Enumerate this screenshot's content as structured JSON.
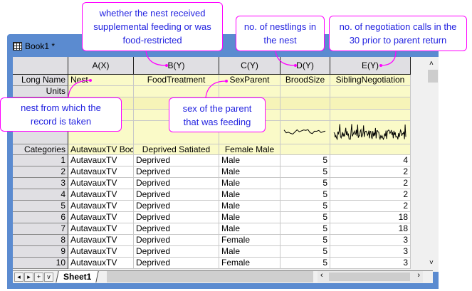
{
  "window": {
    "title": "Book1 *"
  },
  "columns": [
    {
      "header": "A(X)",
      "long_name": "Nest",
      "categories": "AutavauxTV Boc"
    },
    {
      "header": "B(Y)",
      "long_name": "FoodTreatment",
      "categories": "Deprived Satiated"
    },
    {
      "header": "C(Y)",
      "long_name": "SexParent",
      "categories": "Female Male"
    },
    {
      "header": "D(Y)",
      "long_name": "BroodSize",
      "categories": ""
    },
    {
      "header": "E(Y)",
      "long_name": "SiblingNegotiation",
      "categories": ""
    }
  ],
  "row_labels": {
    "long_name": "Long Name",
    "units": "Units",
    "categories": "Categories"
  },
  "rows": [
    [
      "1",
      "AutavauxTV",
      "Deprived",
      "Male",
      "5",
      "4"
    ],
    [
      "2",
      "AutavauxTV",
      "Deprived",
      "Male",
      "5",
      "2"
    ],
    [
      "3",
      "AutavauxTV",
      "Deprived",
      "Male",
      "5",
      "2"
    ],
    [
      "4",
      "AutavauxTV",
      "Deprived",
      "Male",
      "5",
      "2"
    ],
    [
      "5",
      "AutavauxTV",
      "Deprived",
      "Male",
      "5",
      "2"
    ],
    [
      "6",
      "AutavauxTV",
      "Deprived",
      "Male",
      "5",
      "18"
    ],
    [
      "7",
      "AutavauxTV",
      "Deprived",
      "Male",
      "5",
      "18"
    ],
    [
      "8",
      "AutavauxTV",
      "Deprived",
      "Female",
      "5",
      "3"
    ],
    [
      "9",
      "AutavauxTV",
      "Deprived",
      "Male",
      "5",
      "3"
    ],
    [
      "10",
      "AutavauxTV",
      "Deprived",
      "Female",
      "5",
      "3"
    ]
  ],
  "sheet_tab": "Sheet1",
  "tab_nav": [
    "◂",
    "▸",
    "+",
    "v"
  ],
  "callouts": {
    "food": "whether the nest received supplemental feeding or was food-restricted",
    "brood": "no. of nestlings in the nest",
    "negotiation": "no. of negotiation calls in the 30 prior to parent return",
    "nest": "nest from which the record is taken",
    "sex": "sex of the parent that was feeding"
  },
  "colors": {
    "callout_border": "#ff00ff",
    "callout_text": "#2323e0",
    "window_frame": "#5b8bd0",
    "meta_row": "#fafac8"
  }
}
